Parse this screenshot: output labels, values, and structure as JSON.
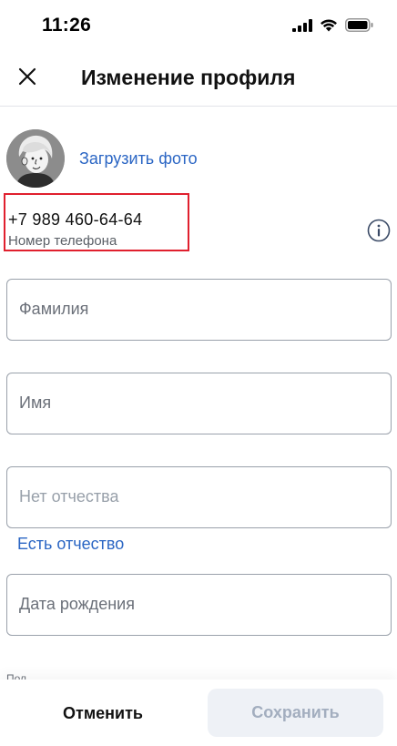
{
  "status_bar": {
    "time": "11:26"
  },
  "header": {
    "title": "Изменение профиля"
  },
  "profile": {
    "upload_photo_label": "Загрузить фото",
    "phone_value": "+7 989 460-64-64",
    "phone_label": "Номер телефона"
  },
  "form": {
    "surname_placeholder": "Фамилия",
    "name_placeholder": "Имя",
    "patronymic_placeholder": "Нет отчества",
    "has_patronymic_link": "Есть отчество",
    "birth_date_placeholder": "Дата рождения",
    "gender_label": "Пол"
  },
  "actions": {
    "cancel_label": "Отменить",
    "save_label": "Сохранить"
  },
  "icons": {
    "close": "close-icon",
    "info": "info-icon",
    "signal": "cellular-signal-icon",
    "wifi": "wifi-icon",
    "battery": "battery-icon"
  },
  "colors": {
    "accent_link": "#2b66c4",
    "highlight_border": "#e0202e",
    "save_disabled_bg": "#eef1f6",
    "save_disabled_text": "#a3aebf"
  }
}
